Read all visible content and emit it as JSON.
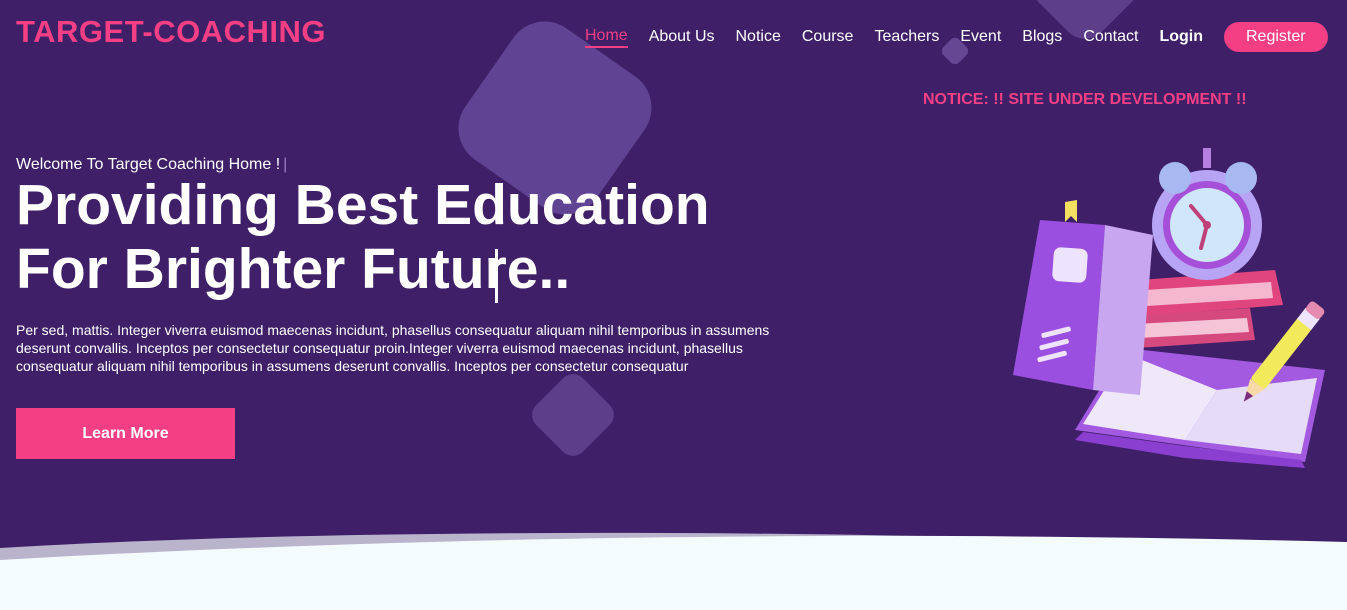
{
  "header": {
    "logo": "TARGET-COACHING",
    "nav": [
      {
        "label": "Home",
        "active": true
      },
      {
        "label": "About Us"
      },
      {
        "label": "Notice"
      },
      {
        "label": "Course"
      },
      {
        "label": "Teachers"
      },
      {
        "label": "Event"
      },
      {
        "label": "Blogs"
      },
      {
        "label": "Contact"
      }
    ],
    "login": "Login",
    "register": "Register"
  },
  "notice": "NOTICE: !! SITE UNDER DEVELOPMENT !!",
  "hero": {
    "welcome": "Welcome To Target Coaching Home !",
    "welcome_caret": "|",
    "headline": "Providing Best Education For Brighter Future..",
    "paragraph": "Per sed, mattis. Integer viverra euismod maecenas incidunt, phasellus consequatur aliquam nihil temporibus in assumens deserunt convallis. Inceptos per consectetur consequatur proin.Integer viverra euismod maecenas incidunt, phasellus consequatur aliquam nihil temporibus in assumens deserunt convallis. Inceptos per consectetur consequatur",
    "cta": "Learn More"
  },
  "colors": {
    "background": "#3f2068",
    "accent": "#f53f85",
    "wave": "#f4fbfd"
  },
  "icons": [
    "alarm-clock-icon",
    "book-icon",
    "pencil-icon"
  ]
}
